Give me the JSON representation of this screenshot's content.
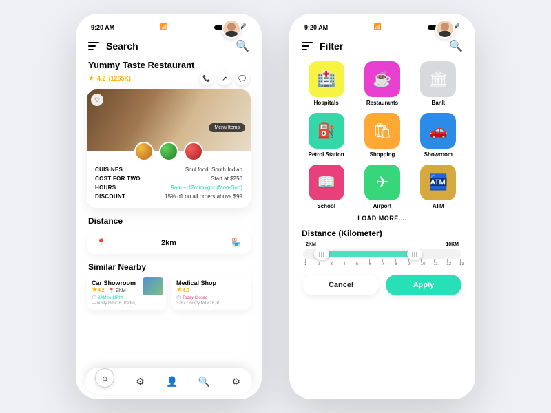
{
  "status_time": "9:20 AM",
  "left": {
    "header_title": "Search",
    "place_name": "Yummy Taste Restaurant",
    "rating": "4.2",
    "reviews": "(1265K)",
    "menu_tag": "Menu Items",
    "info": {
      "cuisines_lbl": "CUISINES",
      "cuisines_val": "Soul food, South Indian",
      "cost_lbl": "COST FOR TWO",
      "cost_val": "Start at $250",
      "hours_lbl": "HOURS",
      "hours_val": "9am – 12midnight (Mon-Sun)",
      "discount_lbl": "DISCOUNT",
      "discount_val": "15% off on all orders above $99"
    },
    "distance_title": "Distance",
    "distance_val": "2km",
    "similar_title": "Similar Nearby",
    "similar": [
      {
        "name": "Car Showroom",
        "rating": "4.2",
        "km": "2KM",
        "hours": "9AM to 11PM",
        "addr": "— ounty Rd #16, Pedro,"
      },
      {
        "name": "Medical Shop",
        "rating": "4.0",
        "km": "",
        "hours": "Today Closed",
        "addr": "3287 County Rd #16, P…"
      }
    ]
  },
  "right": {
    "header_title": "Filter",
    "categories": [
      {
        "label": "Hospitals",
        "color": "#f6f342",
        "icon": "🏥"
      },
      {
        "label": "Restaurants",
        "color": "#e83fd1",
        "icon": "☕"
      },
      {
        "label": "Bank",
        "color": "#d7d9dc",
        "icon": "🏛"
      },
      {
        "label": "Petrol Station",
        "color": "#34d7a7",
        "icon": "⛽"
      },
      {
        "label": "Shopping",
        "color": "#ffa834",
        "icon": "🛍"
      },
      {
        "label": "Showroom",
        "color": "#2d8be8",
        "icon": "🚗"
      },
      {
        "label": "School",
        "color": "#e8407a",
        "icon": "📖"
      },
      {
        "label": "Airport",
        "color": "#37d67a",
        "icon": "✈"
      },
      {
        "label": "ATM",
        "color": "#d6a93e",
        "icon": "🏧"
      }
    ],
    "load_more": "LOAD MORE....",
    "dist_title": "Distance (Kilometer)",
    "slider_min": "2KM",
    "slider_max": "10KM",
    "ticks": [
      "1",
      "2",
      "3",
      "4",
      "5",
      "6",
      "7",
      "8",
      "9",
      "10",
      "11",
      "12",
      "13"
    ],
    "cancel": "Cancel",
    "apply": "Apply"
  }
}
